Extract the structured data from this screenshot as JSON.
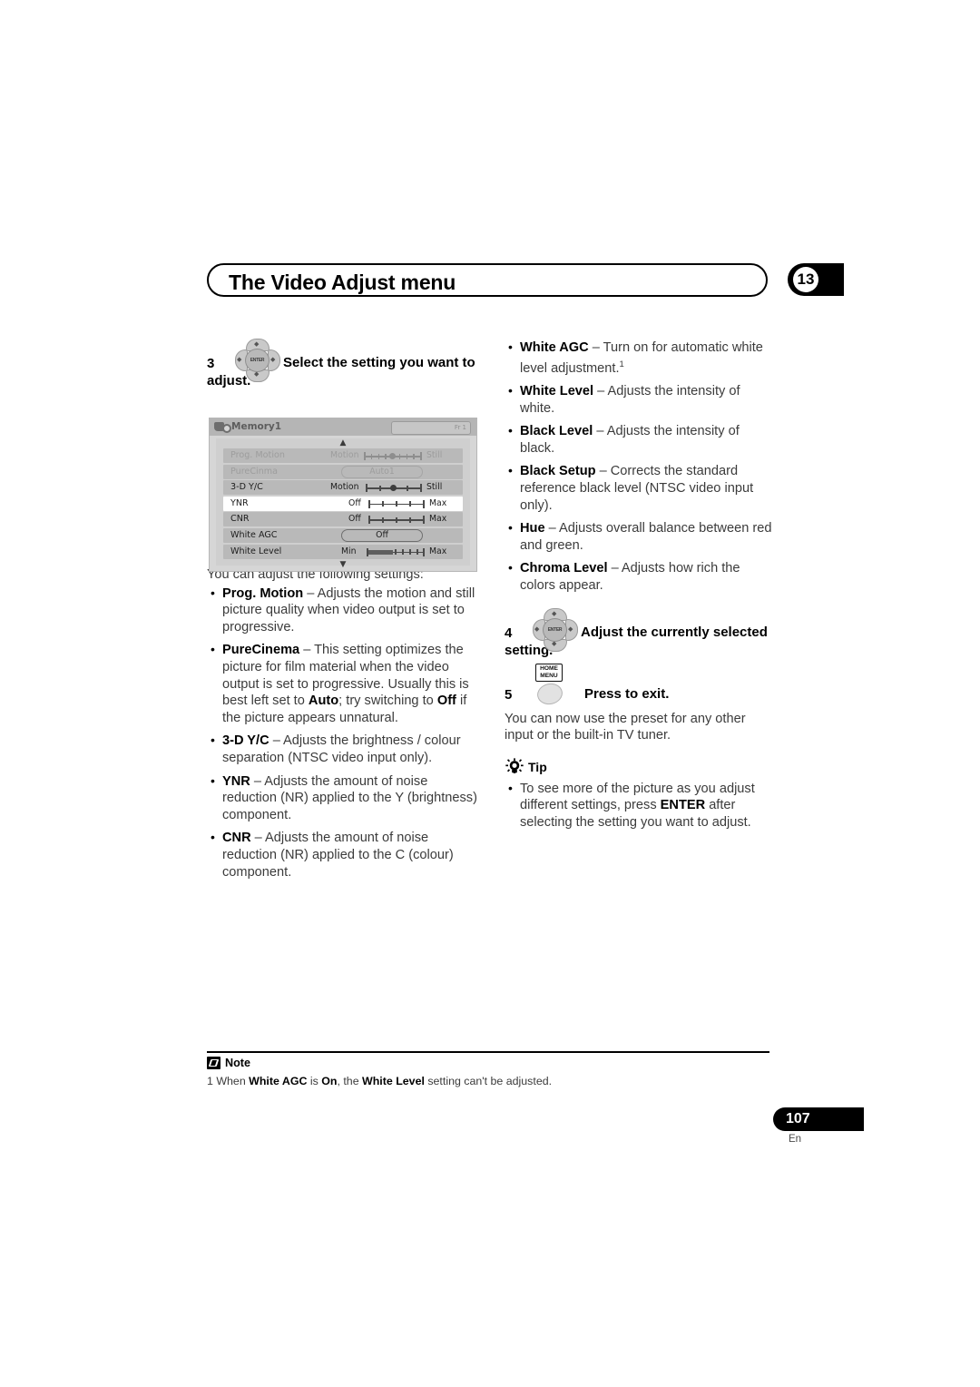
{
  "header": {
    "title": "The Video Adjust menu",
    "chapter": "13"
  },
  "left_column": {
    "step3": {
      "number": "3",
      "icon": "cursor-pad-icon",
      "enter_label": "ENTER",
      "text_first_line": "Select the setting you want to",
      "text_rest": "adjust."
    },
    "osd": {
      "title": "Memory1",
      "pill_text": "Fr 1",
      "up_arrow": "▲",
      "down_arrow": "▼",
      "rows": [
        {
          "label": "Prog. Motion",
          "type": "slider",
          "min": "Motion",
          "max": "Still",
          "ticks": 9,
          "value_index": 4,
          "state": "disabled"
        },
        {
          "label": "PureCinma",
          "type": "option",
          "option": "Auto1",
          "state": "disabled"
        },
        {
          "label": "3-D Y/C",
          "type": "slider",
          "min": "Motion",
          "max": "Still",
          "ticks": 5,
          "value_index": 2,
          "state": "normal"
        },
        {
          "label": "YNR",
          "type": "slider",
          "min": "Off",
          "max": "Max",
          "ticks": 5,
          "value_index": 0,
          "state": "selected"
        },
        {
          "label": "CNR",
          "type": "slider",
          "min": "Off",
          "max": "Max",
          "ticks": 5,
          "value_index": 0,
          "state": "normal"
        },
        {
          "label": "White AGC",
          "type": "option",
          "option": "Off",
          "state": "normal"
        },
        {
          "label": "White Level",
          "type": "bar",
          "min": "Min",
          "max": "Max",
          "ticks": 5,
          "fill_percent": 45,
          "state": "normal"
        }
      ]
    },
    "intro": "You can adjust the following settings:",
    "settings": [
      {
        "term": "Prog. Motion",
        "desc": " – Adjusts the motion and still picture quality when video output is set to progressive."
      },
      {
        "term": "PureCinema",
        "desc": " –  This setting optimizes the picture for film material when the video output is set to progressive. Usually this is best left set to ",
        "bold2": "Auto",
        "desc2": "; try switching to ",
        "bold3": "Off",
        "desc3": " if the picture appears unnatural."
      },
      {
        "term": "3-D Y/C",
        "desc": " – Adjusts the brightness / colour separation (NTSC video input only)."
      },
      {
        "term": "YNR",
        "desc": " – Adjusts the amount of noise reduction (NR) applied to the Y (brightness) component."
      },
      {
        "term": "CNR",
        "desc": " – Adjusts the amount of noise reduction (NR) applied to the C (colour) component."
      }
    ]
  },
  "right_column": {
    "settings": [
      {
        "term": "White AGC",
        "desc": " – Turn on for automatic white level adjustment.",
        "footnote": "1"
      },
      {
        "term": "White Level",
        "desc": " – Adjusts the intensity of white."
      },
      {
        "term": "Black Level",
        "desc": " – Adjusts the intensity of black."
      },
      {
        "term": "Black Setup",
        "desc": " – Corrects the standard reference black level (NTSC video input only)."
      },
      {
        "term": "Hue",
        "desc": " – Adjusts overall balance between red and green."
      },
      {
        "term": "Chroma Level",
        "desc": " – Adjusts how rich the colors appear."
      }
    ],
    "step4": {
      "number": "4",
      "icon": "cursor-pad-icon",
      "enter_label": "ENTER",
      "text_first_line": "Adjust the currently selected",
      "text_rest": "setting."
    },
    "step5": {
      "number": "5",
      "icon": "home-menu-button-icon",
      "icon_label_line1": "HOME",
      "icon_label_line2": "MENU",
      "text": "Press to exit."
    },
    "after_steps": "You can now use the preset for any other input or the built-in TV tuner.",
    "tip": {
      "icon": "lightbulb-icon",
      "label": "Tip",
      "bullet_pre": "To see more of the picture as you adjust different settings, press ",
      "bullet_bold": "ENTER",
      "bullet_post": " after selecting the setting you want to adjust."
    }
  },
  "footer": {
    "note_icon": "note-pencil-icon",
    "note_label": "Note",
    "note_number": "1",
    "note_pre": " When ",
    "note_b1": "White AGC",
    "note_mid1": " is ",
    "note_b2": "On",
    "note_mid2": ", the ",
    "note_b3": "White Level",
    "note_post": " setting can't be adjusted.",
    "page_number": "107",
    "language": "En"
  }
}
